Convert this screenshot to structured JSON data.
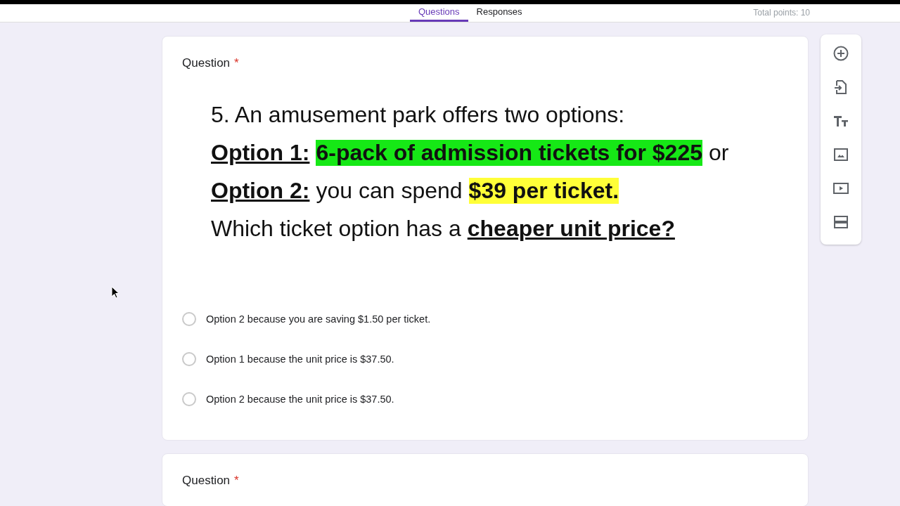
{
  "header": {
    "tabs": [
      {
        "label": "Questions",
        "selected": true
      },
      {
        "label": "Responses",
        "selected": false
      }
    ],
    "total_points": "Total points: 10"
  },
  "question": {
    "label": "Question",
    "required": true,
    "required_mark": "*",
    "image_lines": [
      [
        {
          "text": "5. An amusement park offers two options:",
          "kind": "plain"
        }
      ],
      [
        {
          "text": "Option 1:",
          "kind": "bold_underline"
        },
        {
          "text": "6-pack of admission tickets for $225",
          "kind": "green_highlight"
        },
        {
          "text": "or",
          "kind": "plain"
        }
      ],
      [
        {
          "text": "Option 2:",
          "kind": "bold_underline"
        },
        {
          "text": "you can spend",
          "kind": "plain"
        },
        {
          "text": "$39 per ticket.",
          "kind": "yellow_highlight"
        }
      ],
      [
        {
          "text": "Which ticket option has a",
          "kind": "plain"
        },
        {
          "text": "cheaper unit price?",
          "kind": "bold_underline"
        }
      ]
    ],
    "options": [
      {
        "label": "Option 2 because you are saving $1.50 per ticket.",
        "selected": false
      },
      {
        "label": "Option 1 because the unit price is $37.50.",
        "selected": false
      },
      {
        "label": "Option 2 because the unit price is $37.50.",
        "selected": false
      }
    ]
  },
  "next_question": {
    "label": "Question",
    "required": true,
    "required_mark": "*"
  }
}
